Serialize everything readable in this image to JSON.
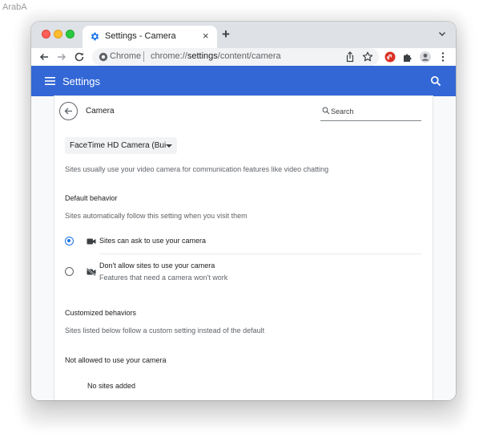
{
  "watermark": "ArabA",
  "tab": {
    "title": "Settings - Camera",
    "close": "×"
  },
  "newtab": "+",
  "omnibox": {
    "site": "Chrome",
    "url_prefix": "chrome://",
    "url_host": "settings",
    "url_path": "/content/camera"
  },
  "appbar": {
    "title": "Settings"
  },
  "page": {
    "title": "Camera",
    "search_placeholder": "Search",
    "device_select": "FaceTime HD Camera (Built-in)",
    "description": "Sites usually use your video camera for communication features like video chatting",
    "default_behavior": {
      "heading": "Default behavior",
      "subtitle": "Sites automatically follow this setting when you visit them",
      "options": [
        {
          "label": "Sites can ask to use your camera",
          "selected": true
        },
        {
          "label": "Don't allow sites to use your camera",
          "sublabel": "Features that need a camera won't work",
          "selected": false
        }
      ]
    },
    "customized": {
      "heading": "Customized behaviors",
      "subtitle": "Sites listed below follow a custom setting instead of the default",
      "not_allowed_heading": "Not allowed to use your camera",
      "empty_text": "No sites added"
    }
  },
  "colors": {
    "accent": "#3367d6",
    "radio": "#1a73e8",
    "extension_red": "#d93025"
  }
}
